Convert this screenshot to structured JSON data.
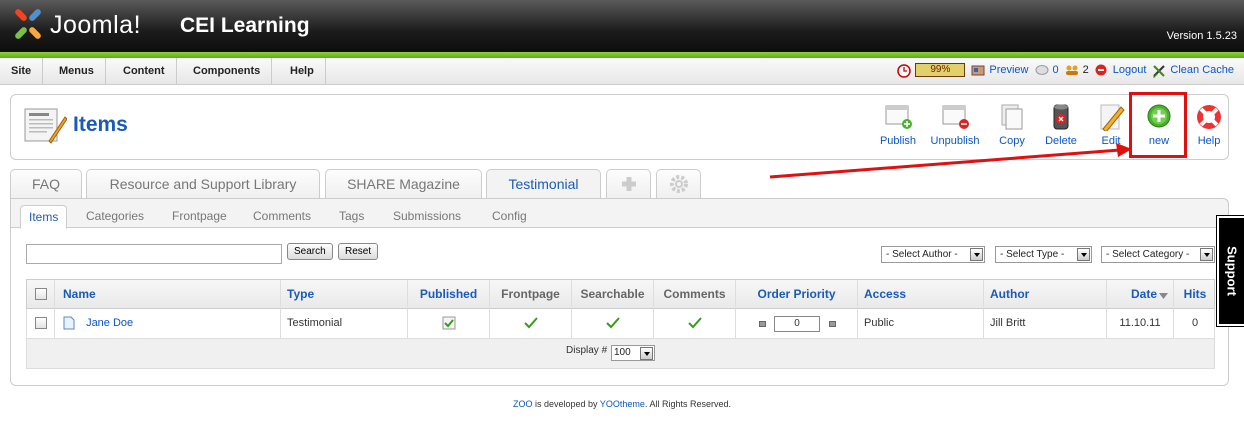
{
  "header": {
    "logo_text": "Joomla!",
    "site_name": "CEI Learning",
    "version": "Version 1.5.23"
  },
  "menubar": {
    "items": [
      "Site",
      "Menus",
      "Content",
      "Components",
      "Help"
    ],
    "status": {
      "progress": "99%",
      "preview": "Preview",
      "messages": "0",
      "users": "2",
      "logout": "Logout",
      "clean_cache": "Clean Cache"
    }
  },
  "toolbar": {
    "title": "Items",
    "buttons": {
      "publish": "Publish",
      "unpublish": "Unpublish",
      "copy": "Copy",
      "delete": "Delete",
      "edit": "Edit",
      "new": "new",
      "help": "Help"
    }
  },
  "main_tabs": [
    "FAQ",
    "Resource and Support Library",
    "SHARE Magazine",
    "Testimonial"
  ],
  "sub_tabs": [
    "Items",
    "Categories",
    "Frontpage",
    "Comments",
    "Tags",
    "Submissions",
    "Config"
  ],
  "filters": {
    "search_value": "",
    "search_button": "Search",
    "reset_button": "Reset",
    "author": "- Select Author -",
    "type": "- Select Type -",
    "category": "- Select Category -"
  },
  "table": {
    "headers": {
      "name": "Name",
      "type": "Type",
      "published": "Published",
      "frontpage": "Frontpage",
      "searchable": "Searchable",
      "comments": "Comments",
      "order": "Order Priority",
      "access": "Access",
      "author": "Author",
      "date": "Date",
      "hits": "Hits"
    },
    "rows": [
      {
        "name": "Jane Doe",
        "type": "Testimonial",
        "order": "0",
        "access": "Public",
        "author": "Jill Britt",
        "date": "11.10.11",
        "hits": "0"
      }
    ],
    "display_label": "Display #",
    "display_value": "100"
  },
  "footer": {
    "zoo": "ZOO",
    "middle": " is developed by ",
    "yootheme": "YOOtheme",
    "rights": ". All Rights Reserved."
  },
  "support_tab": "Support",
  "colors": {
    "accent": "#1a5bb8",
    "highlight": "#e01010",
    "header_green": "#6fb825"
  }
}
